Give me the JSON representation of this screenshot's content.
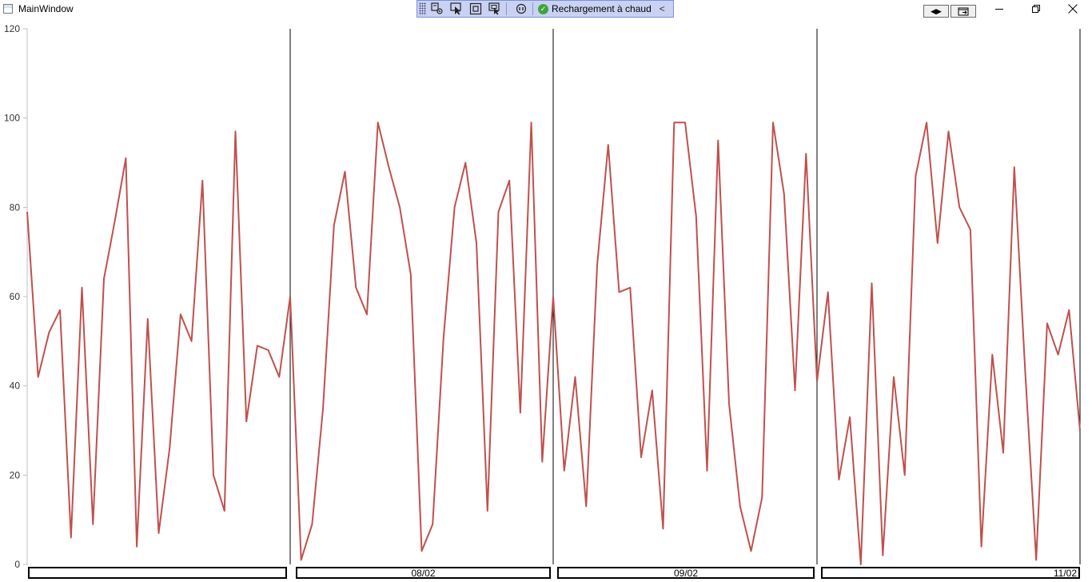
{
  "window": {
    "title": "MainWindow"
  },
  "devbar": {
    "hot_reload_label": "Rechargement à chaud"
  },
  "chart_data": {
    "type": "line",
    "ylim": [
      0,
      120
    ],
    "yticks": [
      0,
      20,
      40,
      60,
      80,
      100,
      120
    ],
    "grid": false,
    "series_color": "#c0504d",
    "panels": [
      {
        "label": "",
        "values": [
          79,
          42,
          52,
          57,
          6,
          62,
          9,
          64,
          77,
          91,
          4,
          55,
          7,
          26,
          56,
          50,
          86,
          20,
          12,
          97,
          32,
          49,
          48,
          42,
          60
        ]
      },
      {
        "label": "08/02",
        "values": [
          60,
          1,
          9,
          35,
          76,
          88,
          62,
          56,
          99,
          89,
          80,
          65,
          3,
          9,
          51,
          80,
          90,
          72,
          12,
          79,
          86,
          34,
          99,
          23,
          60
        ]
      },
      {
        "label": "09/02",
        "values": [
          60,
          21,
          42,
          13,
          67,
          94,
          61,
          62,
          24,
          39,
          8,
          99,
          99,
          78,
          21,
          95,
          36,
          13,
          3,
          15,
          99,
          83,
          39,
          92,
          41
        ]
      },
      {
        "label": "11/02",
        "values": [
          41,
          61,
          19,
          33,
          0,
          63,
          2,
          42,
          20,
          87,
          99,
          72,
          97,
          80,
          75,
          4,
          47,
          25,
          89,
          43,
          1,
          54,
          47,
          57,
          30
        ]
      }
    ]
  }
}
